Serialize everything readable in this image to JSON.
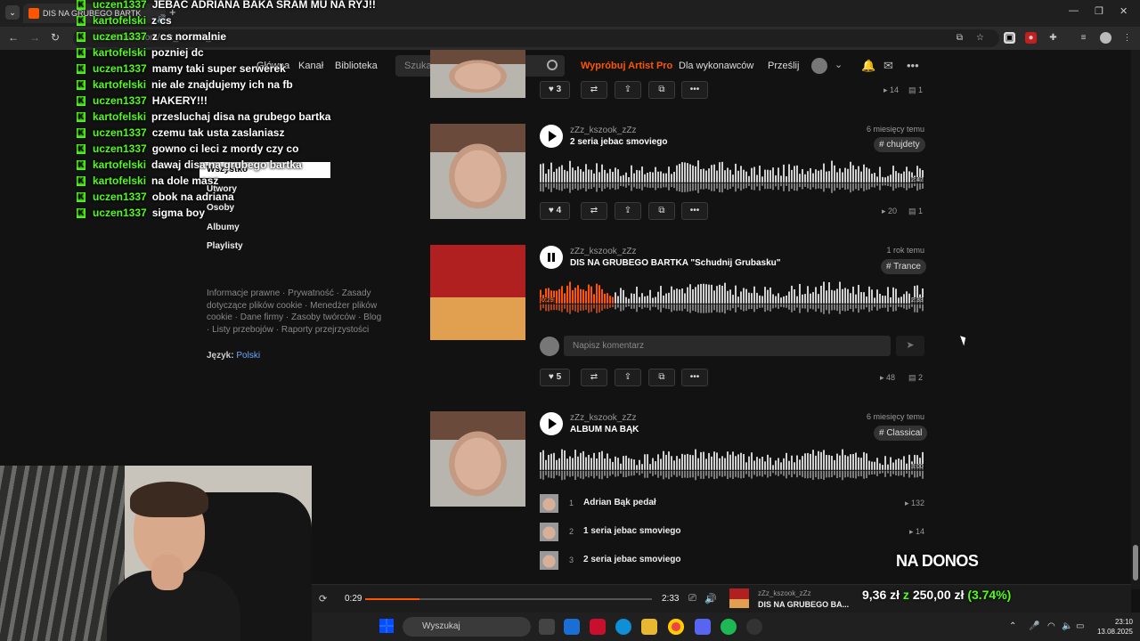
{
  "browser": {
    "tab_title": "DIS NA GRUBEGO BARTK",
    "url": "soundcloud.com/zzz_kszook_zzz"
  },
  "header": {
    "nav": [
      "Główna",
      "Kanał",
      "Biblioteka"
    ],
    "search_placeholder": "Szukaj",
    "artist_pro": "Wypróbuj Artist Pro",
    "for_artists": "Dla wykonawców",
    "upload": "Prześlij"
  },
  "chat": [
    {
      "user": "uczen1337",
      "msg": "JEBAC ADRIANA BAKA SRAM MU NA RYJ!!"
    },
    {
      "user": "kartofelski",
      "msg": "z cs"
    },
    {
      "user": "uczen1337",
      "msg": "z cs normalnie"
    },
    {
      "user": "kartofelski",
      "msg": "pozniej dc"
    },
    {
      "user": "uczen1337",
      "msg": "mamy taki super serwerek"
    },
    {
      "user": "kartofelski",
      "msg": "nie ale znajdujemy ich na fb"
    },
    {
      "user": "uczen1337",
      "msg": "HAKERY!!!"
    },
    {
      "user": "kartofelski",
      "msg": "przesluchaj disa na grubego bartka"
    },
    {
      "user": "uczen1337",
      "msg": "czemu tak usta zaslaniasz"
    },
    {
      "user": "uczen1337",
      "msg": "gowno ci leci z mordy czy co"
    },
    {
      "user": "kartofelski",
      "msg": "dawaj disa na grubego bartka"
    },
    {
      "user": "kartofelski",
      "msg": "na dole masz"
    },
    {
      "user": "uczen1337",
      "msg": "obok na adriana"
    },
    {
      "user": "uczen1337",
      "msg": "sigma boy"
    }
  ],
  "filters": {
    "active": "Wszystko",
    "items": [
      "Utwory",
      "Osoby",
      "Albumy",
      "Playlisty"
    ]
  },
  "footer": {
    "links": "Informacje prawne · Prywatność · Zasady dotyczące plików cookie · Menedżer plików cookie · Dane firmy · Zasoby twórców · Blog · Listy przebojów · Raporty przejrzystości",
    "language_label": "Język:",
    "language": "Polski"
  },
  "tracks": [
    {
      "likes": "3",
      "plays": "14",
      "comments": "1"
    },
    {
      "artist": "zZz_kszook_zZz",
      "title": "2 seria jebac smoviego",
      "date": "6 miesięcy temu",
      "tag": "# chujdety",
      "duration": "2:47",
      "likes": "4",
      "plays": "20",
      "comments": "1"
    },
    {
      "artist": "zZz_kszook_zZz",
      "title": "DIS NA GRUBEGO BARTKA \"Schudnij Grubasku\"",
      "date": "1 rok temu",
      "tag": "# Trance",
      "elapsed": "0:29",
      "duration": "2:33",
      "progress": 0.19,
      "likes": "5",
      "plays": "48",
      "comments": "2",
      "comment_placeholder": "Napisz komentarz"
    },
    {
      "artist": "zZz_kszook_zZz",
      "title": "ALBUM NA BĄK",
      "date": "6 miesięcy temu",
      "tag": "# Classical",
      "duration": "3:00"
    }
  ],
  "album_tracks": [
    {
      "num": "1",
      "title": "Adrian Bąk pedał",
      "plays": "132"
    },
    {
      "num": "2",
      "title": "1 seria jebac smoviego",
      "plays": "14"
    },
    {
      "num": "3",
      "title": "2 seria jebac smoviego",
      "plays": ""
    }
  ],
  "player": {
    "elapsed": "0:29",
    "duration": "2:33",
    "progress": 0.19,
    "artist": "zZz_kszook_zZz",
    "title": "DIS NA GRUBEGO BA..."
  },
  "donation": {
    "title": "NA DONOS",
    "current": "9,36 zł",
    "sep": "z",
    "goal": "250,00 zł",
    "percent": "(3.74%)"
  },
  "taskbar": {
    "search_placeholder": "Wyszukaj",
    "time": "23:10",
    "date": "13.08.2025"
  },
  "colors": {
    "accent": "#ff5500",
    "kick_green": "#53fc18"
  }
}
